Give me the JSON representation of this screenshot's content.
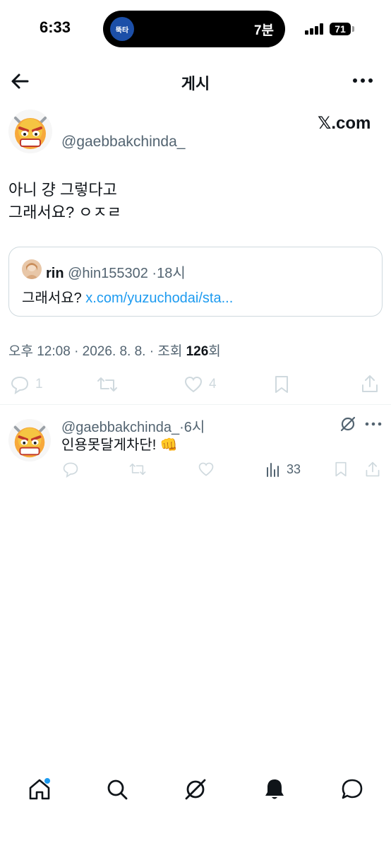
{
  "status_bar": {
    "time": "6:33",
    "island_app_label": "뚝타",
    "island_text": "7분",
    "battery": "71"
  },
  "header": {
    "title": "게시"
  },
  "post": {
    "handle": "@gaebbakchinda_",
    "watermark": "𝕏.com",
    "text_line1": "아니 걍 그렇다고",
    "text_line2": "그래서요? ㅇㅈㄹ",
    "quote": {
      "name": "rin",
      "handle": "@hin155302",
      "time": "·18시",
      "text": "그래서요?",
      "link": "x.com/yuzuchodai/sta..."
    },
    "timestamp_prefix": "오후 12:08 · 2026. 8. 8. · 조회 ",
    "views": "126",
    "views_suffix": "회",
    "stats": {
      "replies": "1",
      "likes": "4"
    }
  },
  "reply": {
    "handle": "@gaebbakchinda_",
    "time": "·6시",
    "text": "인용못달게차단! 👊",
    "views": "33"
  },
  "icons": {
    "back": "arrow-left-icon",
    "more": "more-horizontal-icon",
    "reply": "speech-bubble-icon",
    "retweet": "repost-icon",
    "like": "heart-icon",
    "bookmark": "bookmark-icon",
    "share": "share-icon",
    "views": "bar-chart-icon",
    "grok": "grok-icon",
    "home": "home-icon",
    "search": "search-icon",
    "notifications": "bell-icon",
    "messages": "message-icon"
  },
  "colors": {
    "accent": "#1d9bf0",
    "muted": "#536471",
    "faint": "#cfd9de"
  }
}
